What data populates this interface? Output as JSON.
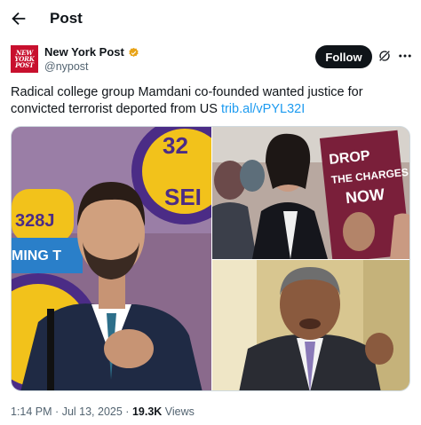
{
  "header": {
    "title": "Post"
  },
  "account": {
    "name": "New York Post",
    "handle": "@nypost",
    "avatar_logo": [
      "NEW",
      "YORK",
      "POST"
    ],
    "follow_label": "Follow"
  },
  "post": {
    "text": "Radical college group Mamdani co-founded wanted justice for convicted terrorist deported from US",
    "link": "trib.al/vPYL32I"
  },
  "media": {
    "sign_text_1": [
      "DROP",
      "THE CHARGES",
      "NOW"
    ],
    "union_sign_fragments": [
      "32",
      "SEI",
      "328J",
      "MING T"
    ]
  },
  "meta": {
    "time": "1:14 PM",
    "date": "Jul 13, 2025",
    "views_count": "19.3K",
    "views_label": "Views"
  },
  "colors": {
    "accent": "#1d9bf0",
    "brand": "#c8102e",
    "verified": "#e8a317"
  }
}
